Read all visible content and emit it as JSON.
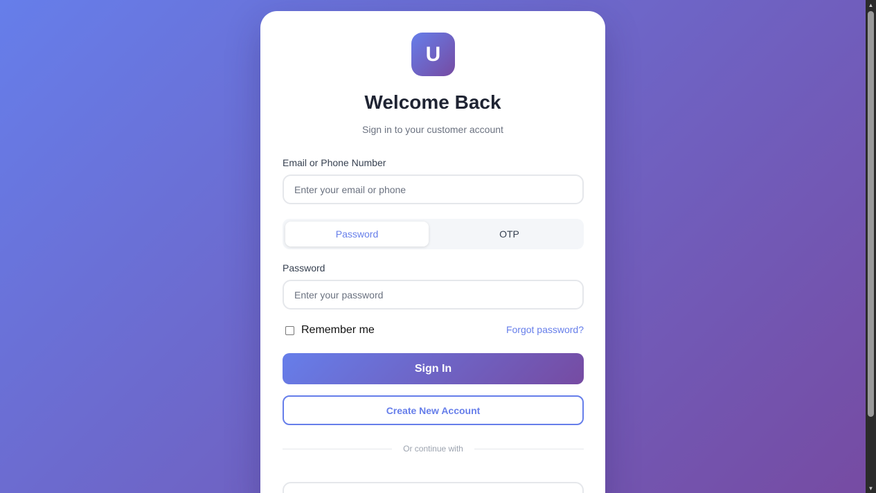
{
  "brand": {
    "logo_letter": "U"
  },
  "header": {
    "title": "Welcome Back",
    "subtitle": "Sign in to your customer account"
  },
  "email": {
    "label": "Email or Phone Number",
    "placeholder": "Enter your email or phone",
    "value": ""
  },
  "auth_tabs": [
    {
      "label": "Password",
      "active": true
    },
    {
      "label": "OTP",
      "active": false
    }
  ],
  "password": {
    "label": "Password",
    "placeholder": "Enter your password",
    "value": ""
  },
  "remember": {
    "label": "Remember me",
    "checked": false
  },
  "forgot_link": "Forgot password?",
  "buttons": {
    "sign_in": "Sign In",
    "create_account": "Create New Account"
  },
  "divider_text": "Or continue with",
  "colors": {
    "gradient_start": "#667eea",
    "gradient_end": "#764ba2",
    "accent": "#667eea"
  }
}
